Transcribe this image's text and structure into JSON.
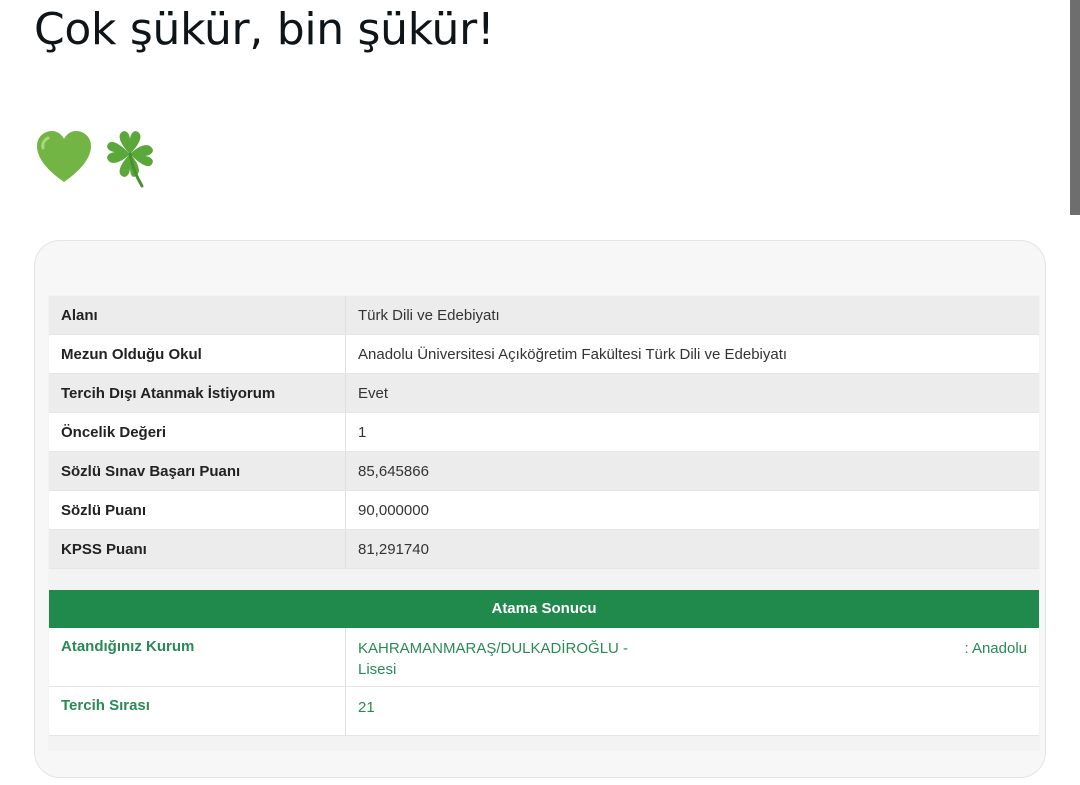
{
  "post": {
    "text": "Çok şükür, bin şükür!",
    "emojis": [
      "green-heart",
      "four-leaf-clover"
    ]
  },
  "info_table": {
    "rows": [
      {
        "label": "Alanı",
        "value": "Türk Dili ve Edebiyatı"
      },
      {
        "label": "Mezun Olduğu Okul",
        "value": "Anadolu Üniversitesi Açıköğretim Fakültesi Türk Dili ve Edebiyatı"
      },
      {
        "label": "Tercih Dışı Atanmak İstiyorum",
        "value": "Evet"
      },
      {
        "label": "Öncelik Değeri",
        "value": "1"
      },
      {
        "label": "Sözlü Sınav Başarı Puanı",
        "value": "85,645866"
      },
      {
        "label": "Sözlü Puanı",
        "value": "90,000000"
      },
      {
        "label": "KPSS Puanı",
        "value": "81,291740"
      }
    ]
  },
  "result": {
    "header": "Atama Sonucu",
    "institution_label": "Atandığınız Kurum",
    "institution_value_part1": "KAHRAMANMARAŞ/DULKADİROĞLU -",
    "institution_value_part2": ": Anadolu",
    "institution_value_line2": "Lisesi",
    "preference_label": "Tercih Sırası",
    "preference_value": "21"
  },
  "colors": {
    "accent_green": "#1f8a4c",
    "result_text_green": "#2a8a55"
  }
}
